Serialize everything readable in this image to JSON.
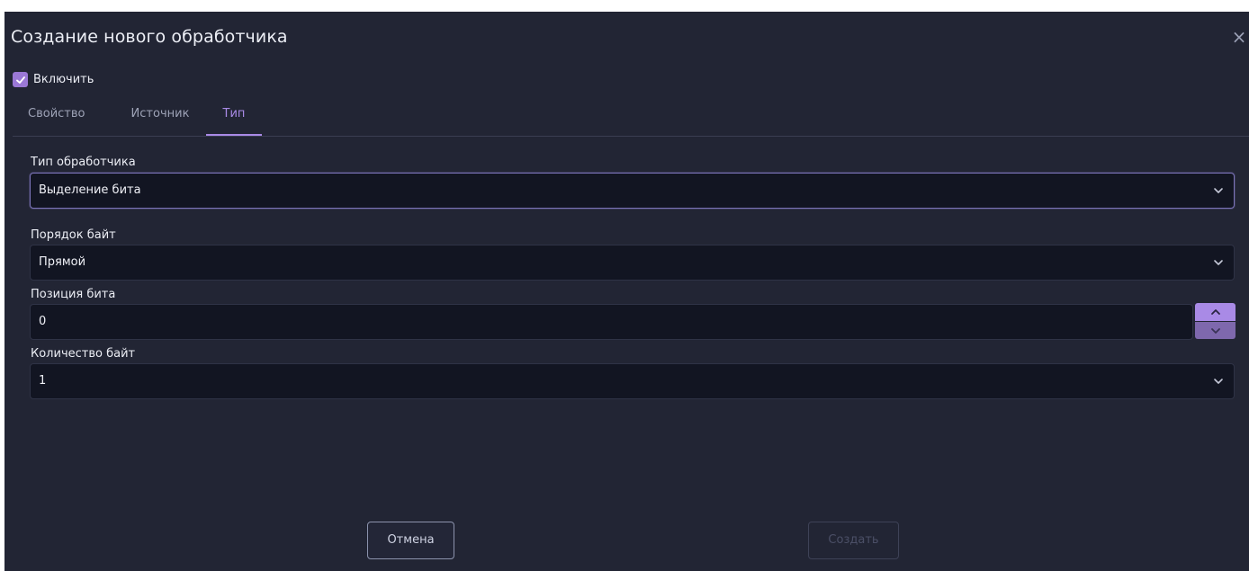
{
  "dialog": {
    "title": "Создание нового обработчика",
    "close_icon": "close-icon",
    "close_glyph": "×"
  },
  "enable": {
    "label": "Включить",
    "checked": true
  },
  "tabs": [
    {
      "label": "Свойство",
      "active": false
    },
    {
      "label": "Источник",
      "active": false
    },
    {
      "label": "Тип",
      "active": true
    }
  ],
  "form": {
    "handler_type": {
      "label": "Тип обработчика",
      "value": "Выделение бита"
    },
    "byte_order": {
      "label": "Порядок байт",
      "value": "Прямой"
    },
    "bit_position": {
      "label": "Позиция бита",
      "value": "0"
    },
    "byte_count": {
      "label": "Количество байт",
      "value": "1"
    }
  },
  "buttons": {
    "cancel": "Отмена",
    "create": "Создать",
    "create_disabled": true
  },
  "colors": {
    "background": "#222534",
    "field_background": "#121522",
    "accent": "#a98ae6"
  }
}
